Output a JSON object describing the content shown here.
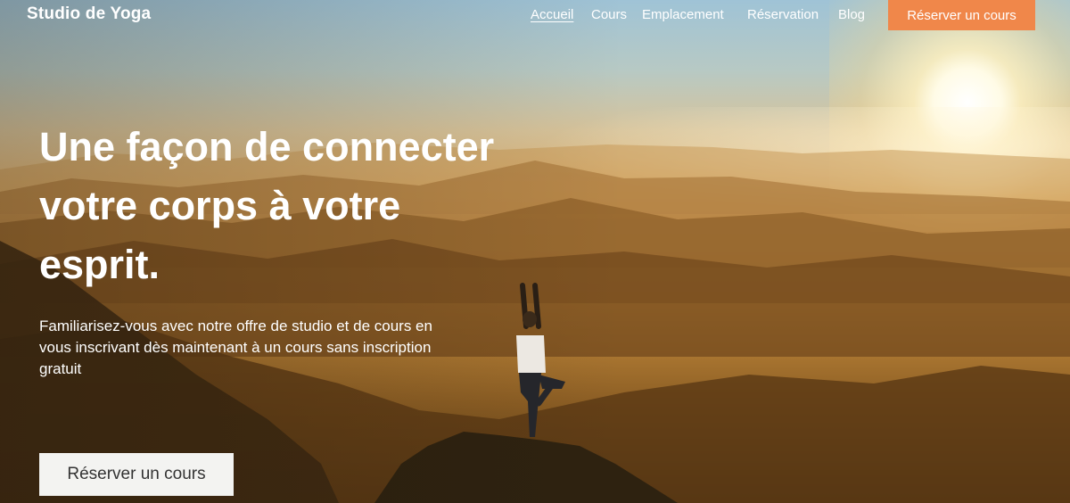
{
  "brand": {
    "name": "Studio de Yoga"
  },
  "nav": {
    "items": [
      {
        "label": "Accueil",
        "active": true
      },
      {
        "label": "Cours",
        "active": false
      },
      {
        "label": "Emplacement",
        "active": false
      },
      {
        "label": "Réservation",
        "active": false
      },
      {
        "label": "Blog",
        "active": false
      }
    ],
    "cta_label": "Réserver un cours"
  },
  "hero": {
    "headline": "Une façon de connecter votre corps à votre esprit.",
    "subtext": "Familiarisez-vous avec notre offre de studio et de cours en vous inscrivant dès maintenant à un cours sans inscription gratuit",
    "cta_label": "Réserver un cours"
  },
  "colors": {
    "accent": "#f0874a",
    "hero_button_bg": "#f3f3f1",
    "text_on_image": "#ffffff"
  }
}
